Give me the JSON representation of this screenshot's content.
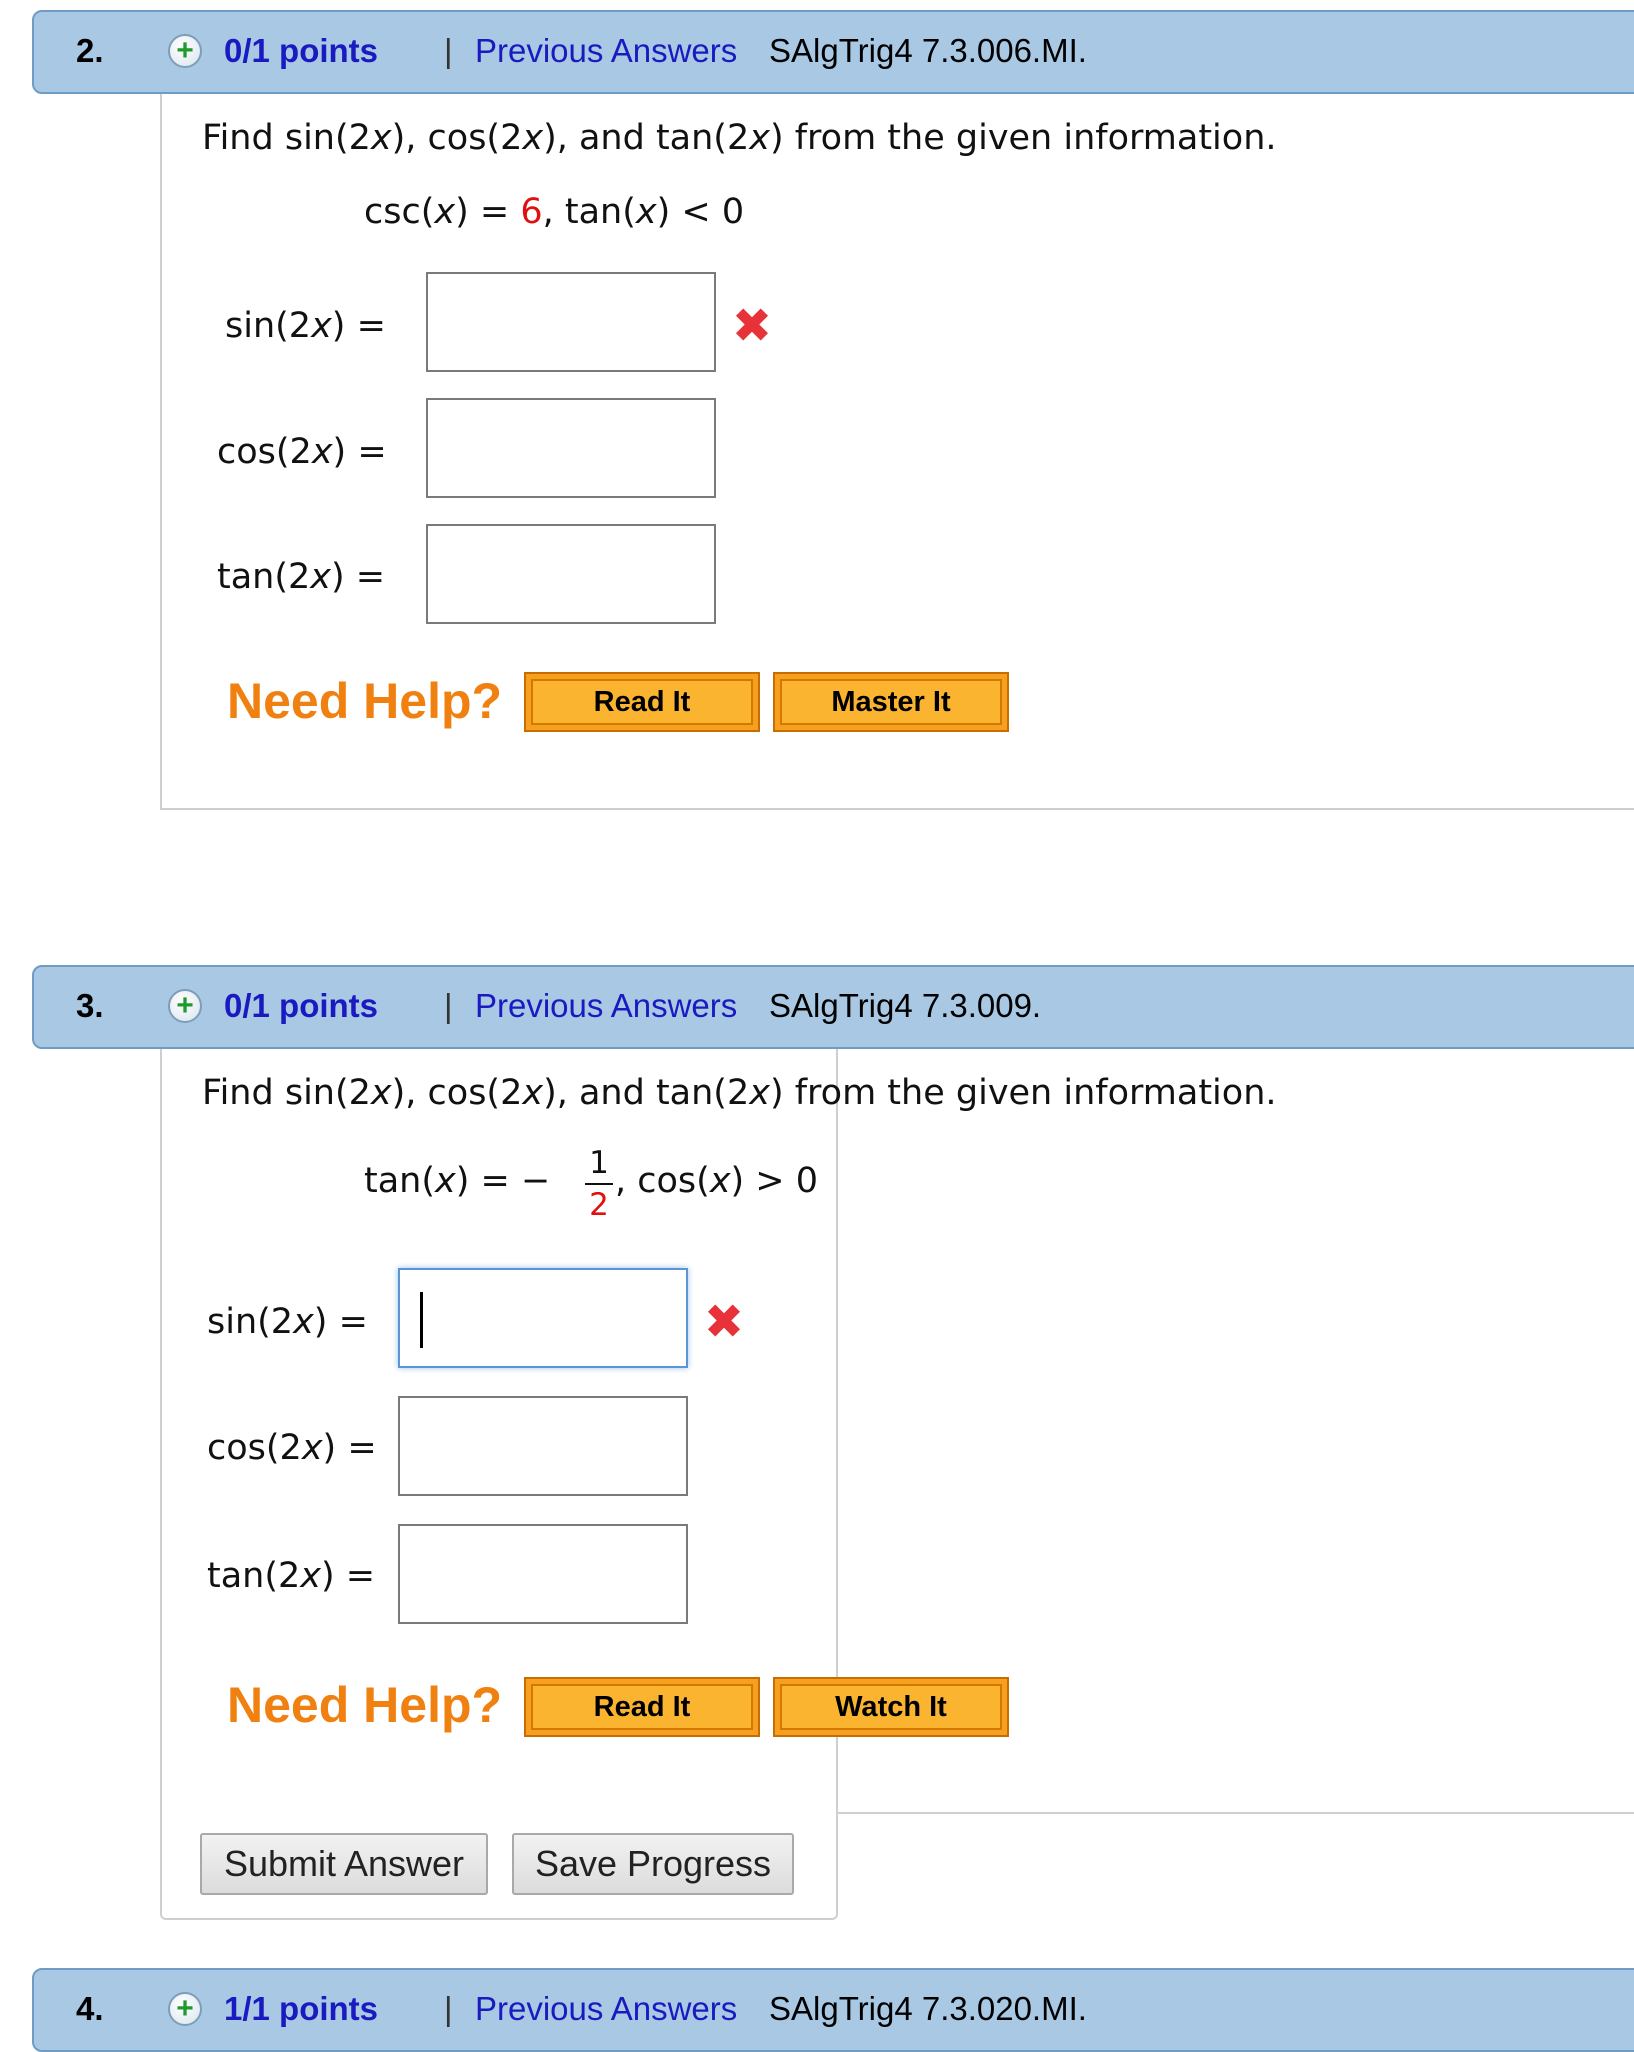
{
  "questions": [
    {
      "number": "2.",
      "points": "0/1 points",
      "separator": "|",
      "previous_answers": "Previous Answers",
      "code": "SAlgTrig4 7.3.006.MI.",
      "prompt_a": "Find sin(2",
      "prompt_x1": "x",
      "prompt_b": "), cos(2",
      "prompt_x2": "x",
      "prompt_c": "), and tan(2",
      "prompt_x3": "x",
      "prompt_d": ") from the given information.",
      "given_a": "csc(",
      "given_x1": "x",
      "given_b": ") = ",
      "given_value": "6",
      "given_c": ",   tan(",
      "given_x2": "x",
      "given_d": ") < 0",
      "rows": [
        {
          "fn": "sin(2",
          "var": "x",
          "end": ")  =",
          "value": "",
          "status": "incorrect"
        },
        {
          "fn": "cos(2",
          "var": "x",
          "end": ")  =",
          "value": ""
        },
        {
          "fn": "tan(2",
          "var": "x",
          "end": ")  =",
          "value": ""
        }
      ],
      "need_help": "Need Help?",
      "help_buttons": [
        "Read It",
        "Master It"
      ]
    },
    {
      "number": "3.",
      "points": "0/1 points",
      "separator": "|",
      "previous_answers": "Previous Answers",
      "code": "SAlgTrig4 7.3.009.",
      "prompt_a": "Find sin(2",
      "prompt_x1": "x",
      "prompt_b": "), cos(2",
      "prompt_x2": "x",
      "prompt_c": "), and tan(2",
      "prompt_x3": "x",
      "prompt_d": ") from the given information.",
      "given_a": "tan(",
      "given_x1": "x",
      "given_b": ") = −",
      "frac_num": "1",
      "frac_den": "2",
      "given_c": ",   cos(",
      "given_x2": "x",
      "given_d": ") > 0",
      "rows": [
        {
          "fn": "sin(2",
          "var": "x",
          "end": ") =",
          "value": "",
          "status": "incorrect"
        },
        {
          "fn": "cos(2",
          "var": "x",
          "end": ") =",
          "value": ""
        },
        {
          "fn": "tan(2",
          "var": "x",
          "end": ") =",
          "value": ""
        }
      ],
      "need_help": "Need Help?",
      "help_buttons": [
        "Read It",
        "Watch It"
      ]
    },
    {
      "number": "4.",
      "points": "1/1 points",
      "separator": "|",
      "previous_answers": "Previous Answers",
      "code": "SAlgTrig4 7.3.020.MI."
    }
  ],
  "actions": {
    "submit": "Submit Answer",
    "save": "Save Progress"
  },
  "colors": {
    "header_bg": "#a8c8e4",
    "link": "#1a1ac0",
    "need_help": "#f08010",
    "given_value": "#e01010",
    "incorrect": "#e8323a"
  }
}
